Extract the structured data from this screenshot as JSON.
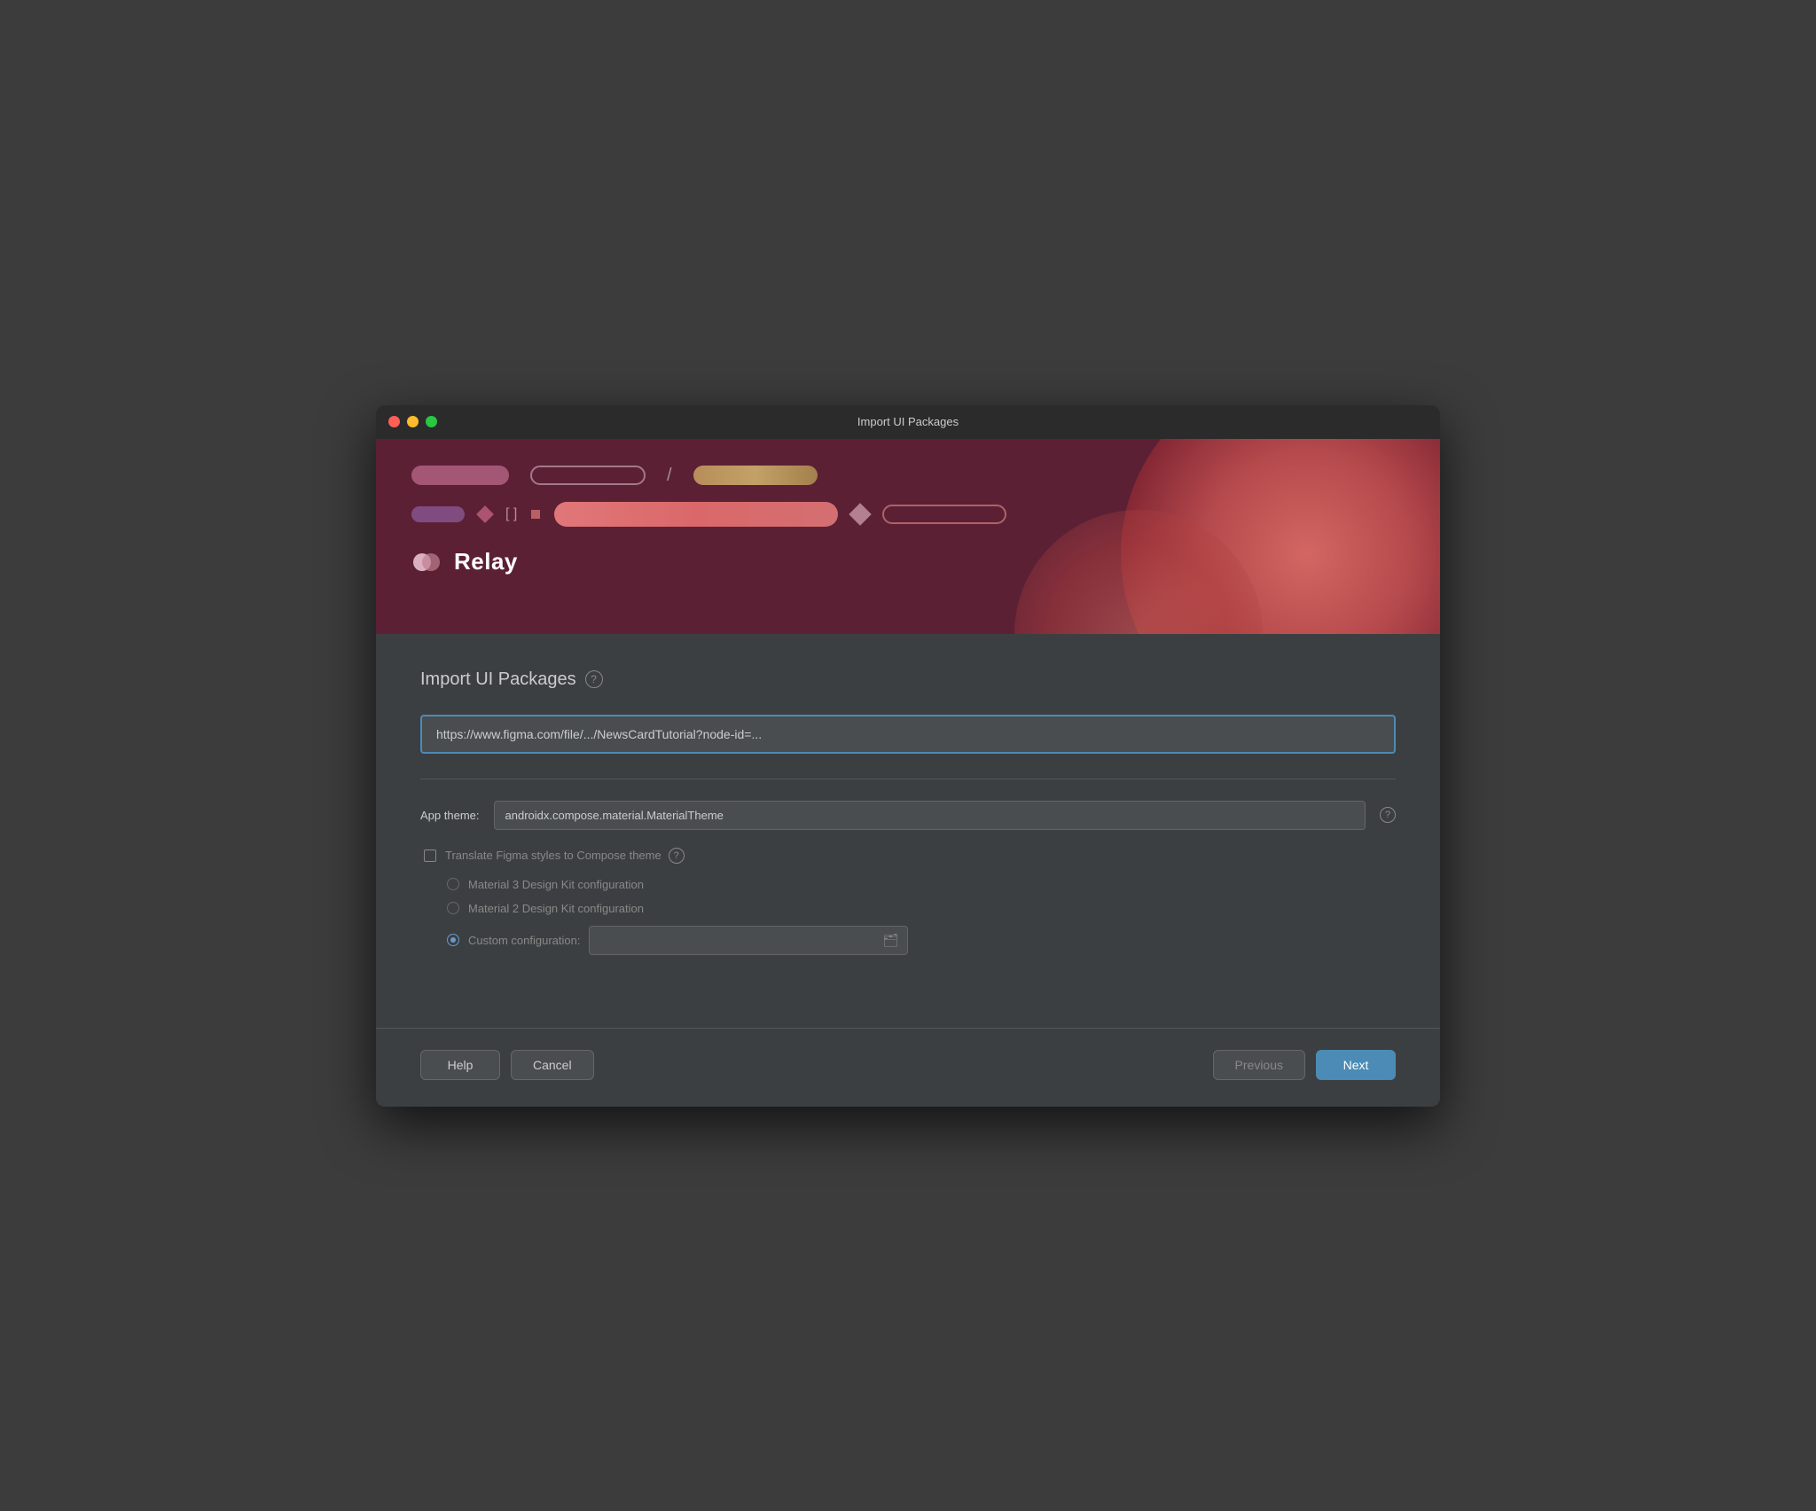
{
  "window": {
    "title": "Import UI Packages"
  },
  "banner": {
    "logo_text": "Relay"
  },
  "main": {
    "section_title": "Import UI Packages",
    "help_icon_label": "?",
    "url_input": {
      "value": "https://www.figma.com/file/.../NewsCardTutorial?node-id=...",
      "placeholder": "https://www.figma.com/file/.../NewsCardTutorial?node-id=..."
    },
    "app_theme_label": "App theme:",
    "app_theme_value": "androidx.compose.material.MaterialTheme",
    "translate_label": "Translate Figma styles to Compose theme",
    "radio_options": [
      {
        "label": "Material 3 Design Kit configuration",
        "selected": false
      },
      {
        "label": "Material 2 Design Kit configuration",
        "selected": false
      },
      {
        "label": "Custom configuration:",
        "selected": true
      }
    ],
    "custom_config_placeholder": ""
  },
  "footer": {
    "help_label": "Help",
    "cancel_label": "Cancel",
    "previous_label": "Previous",
    "next_label": "Next"
  },
  "colors": {
    "accent_blue": "#4b8bb5",
    "border_blue": "#4b8bb5",
    "bg_dark": "#3c3f41",
    "text_primary": "#cccccc",
    "text_muted": "#888888"
  }
}
